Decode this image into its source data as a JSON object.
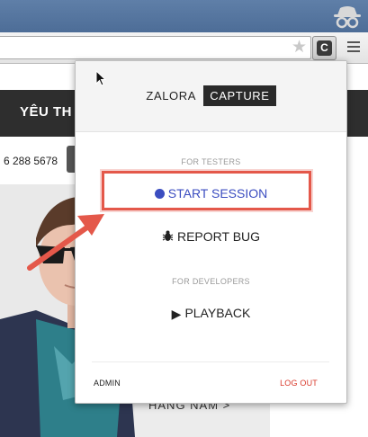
{
  "browser": {
    "incognito_icon": "incognito-icon",
    "star_icon": "star-icon",
    "extension_badge": "C",
    "menu_icon": "hamburger-menu-icon"
  },
  "site": {
    "nav_text": "YÊU TH",
    "phone": "6 288 5678",
    "hero_caption": "HÀNG NĂM >"
  },
  "popup": {
    "brand_part1": "ZALORA",
    "brand_part2": "CAPTURE",
    "testers_label": "FOR TESTERS",
    "start_session": "START SESSION",
    "report_bug": "REPORT BUG",
    "developers_label": "FOR DEVELOPERS",
    "playback": "PLAYBACK",
    "admin": "ADMIN",
    "logout": "LOG OUT"
  },
  "colors": {
    "accent_blue": "#3b4dc0",
    "highlight_red": "#e4584a",
    "logout_red": "#d9392b"
  }
}
